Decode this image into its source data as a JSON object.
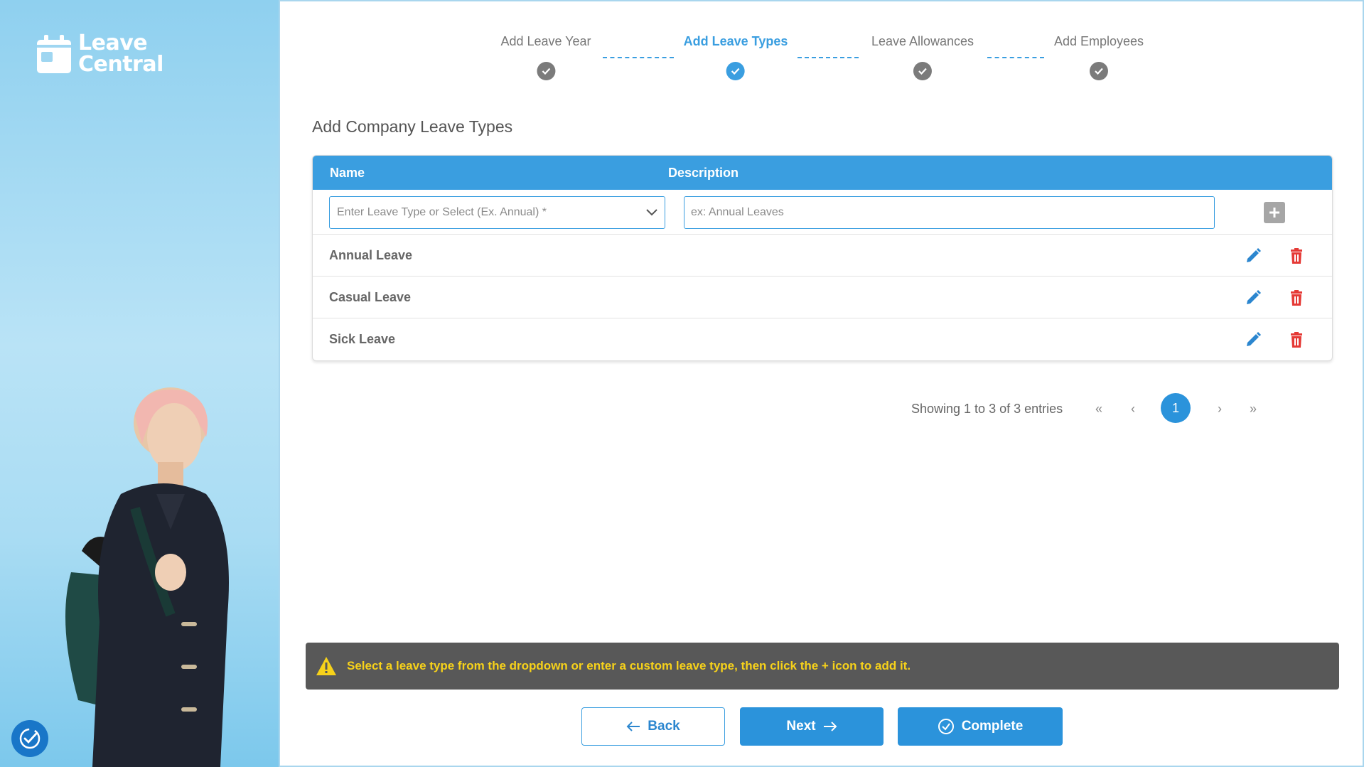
{
  "brand": {
    "line1": "Leave",
    "line2": "Central"
  },
  "stepper": {
    "steps": [
      {
        "label": "Add Leave Year",
        "state": "done"
      },
      {
        "label": "Add Leave Types",
        "state": "active"
      },
      {
        "label": "Leave Allowances",
        "state": "done"
      },
      {
        "label": "Add Employees",
        "state": "done"
      }
    ]
  },
  "section_title": "Add Company Leave Types",
  "table": {
    "headers": {
      "name": "Name",
      "description": "Description"
    },
    "name_placeholder": "Enter Leave Type or Select (Ex. Annual) *",
    "description_placeholder": "ex: Annual Leaves",
    "rows": [
      {
        "name": "Annual Leave"
      },
      {
        "name": "Casual Leave"
      },
      {
        "name": "Sick Leave"
      }
    ]
  },
  "pagination": {
    "info": "Showing 1 to 3 of 3 entries",
    "first": "«",
    "prev": "‹",
    "current": "1",
    "next": "›",
    "last": "»"
  },
  "alert": {
    "text": "Select a leave type from the dropdown or enter a custom leave type, then click the + icon to add it."
  },
  "buttons": {
    "back": "Back",
    "next": "Next",
    "complete": "Complete"
  },
  "colors": {
    "primary": "#3a9ee0",
    "alert_bg": "#585858",
    "alert_text": "#f7d21a",
    "delete": "#e53935"
  }
}
